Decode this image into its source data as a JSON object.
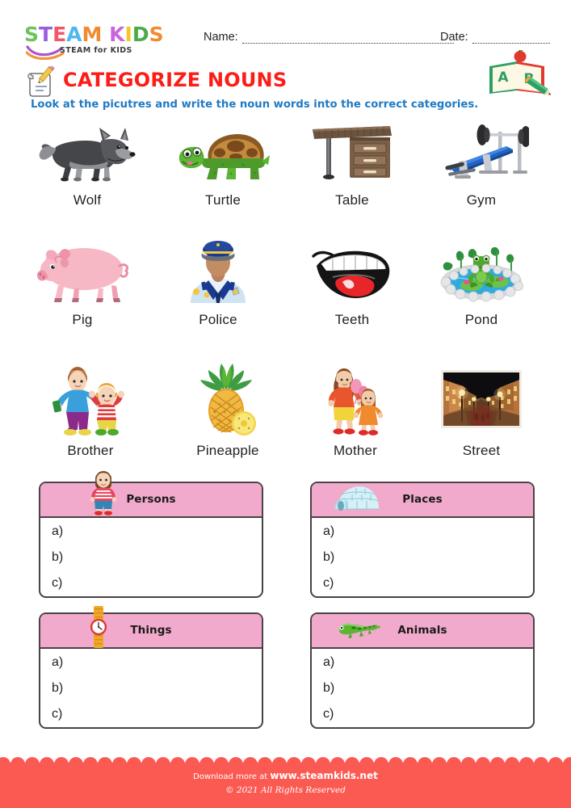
{
  "brand": {
    "logo_line1_parts": [
      {
        "text": "S",
        "color": "#6ec35a"
      },
      {
        "text": "T",
        "color": "#9b5ede"
      },
      {
        "text": "E",
        "color": "#f2566b"
      },
      {
        "text": "A",
        "color": "#4fb8ef"
      },
      {
        "text": "M",
        "color": "#f08b33"
      },
      {
        "text": " ",
        "color": "#ffffff"
      },
      {
        "text": "K",
        "color": "#c765dc"
      },
      {
        "text": "I",
        "color": "#f5c720"
      },
      {
        "text": "D",
        "color": "#4bab4b"
      },
      {
        "text": "S",
        "color": "#f08b33"
      }
    ],
    "logo_tagline": "STEAM for KIDS"
  },
  "header": {
    "name_label": "Name:",
    "date_label": "Date:",
    "name_value": "",
    "date_value": "",
    "name_placeholder": "",
    "date_placeholder": "",
    "book_icon": "abc-book-icon"
  },
  "title": {
    "heading": "CATEGORIZE NOUNS",
    "heading_color": "#fc1d17",
    "subtitle": "Look at the picutres and write the noun words into the correct categories.",
    "subtitle_color": "#1f7ac4",
    "icon": "pencil-scroll-icon"
  },
  "picture_grid": {
    "items": [
      {
        "label": "Wolf",
        "icon": "wolf-icon"
      },
      {
        "label": "Turtle",
        "icon": "turtle-icon"
      },
      {
        "label": "Table",
        "icon": "table-icon"
      },
      {
        "label": "Gym",
        "icon": "gym-bench-icon"
      },
      {
        "label": "Pig",
        "icon": "pig-icon"
      },
      {
        "label": "Police",
        "icon": "police-officer-icon"
      },
      {
        "label": "Teeth",
        "icon": "teeth-mouth-icon"
      },
      {
        "label": "Pond",
        "icon": "pond-frog-icon"
      },
      {
        "label": "Brother",
        "icon": "brothers-icon"
      },
      {
        "label": "Pineapple",
        "icon": "pineapple-icon"
      },
      {
        "label": "Mother",
        "icon": "mother-daughter-icon"
      },
      {
        "label": "Street",
        "icon": "street-night-icon"
      }
    ]
  },
  "answer_boxes": {
    "header_color": "#f2aacc",
    "border_color": "#4a4245",
    "line_labels": [
      "a)",
      "b)",
      "c)"
    ],
    "boxes": [
      {
        "title": "Persons",
        "icon": "boy-icon",
        "a": "",
        "b": "",
        "c": ""
      },
      {
        "title": "Places",
        "icon": "igloo-icon",
        "a": "",
        "b": "",
        "c": ""
      },
      {
        "title": "Things",
        "icon": "watch-icon",
        "a": "",
        "b": "",
        "c": ""
      },
      {
        "title": "Animals",
        "icon": "lizard-icon",
        "a": "",
        "b": "",
        "c": ""
      }
    ]
  },
  "footer": {
    "background": "#fb5a53",
    "download_prefix": "Download more at ",
    "site": "www.steamkids.net",
    "copyright": "© 2021 All Rights Reserved"
  }
}
